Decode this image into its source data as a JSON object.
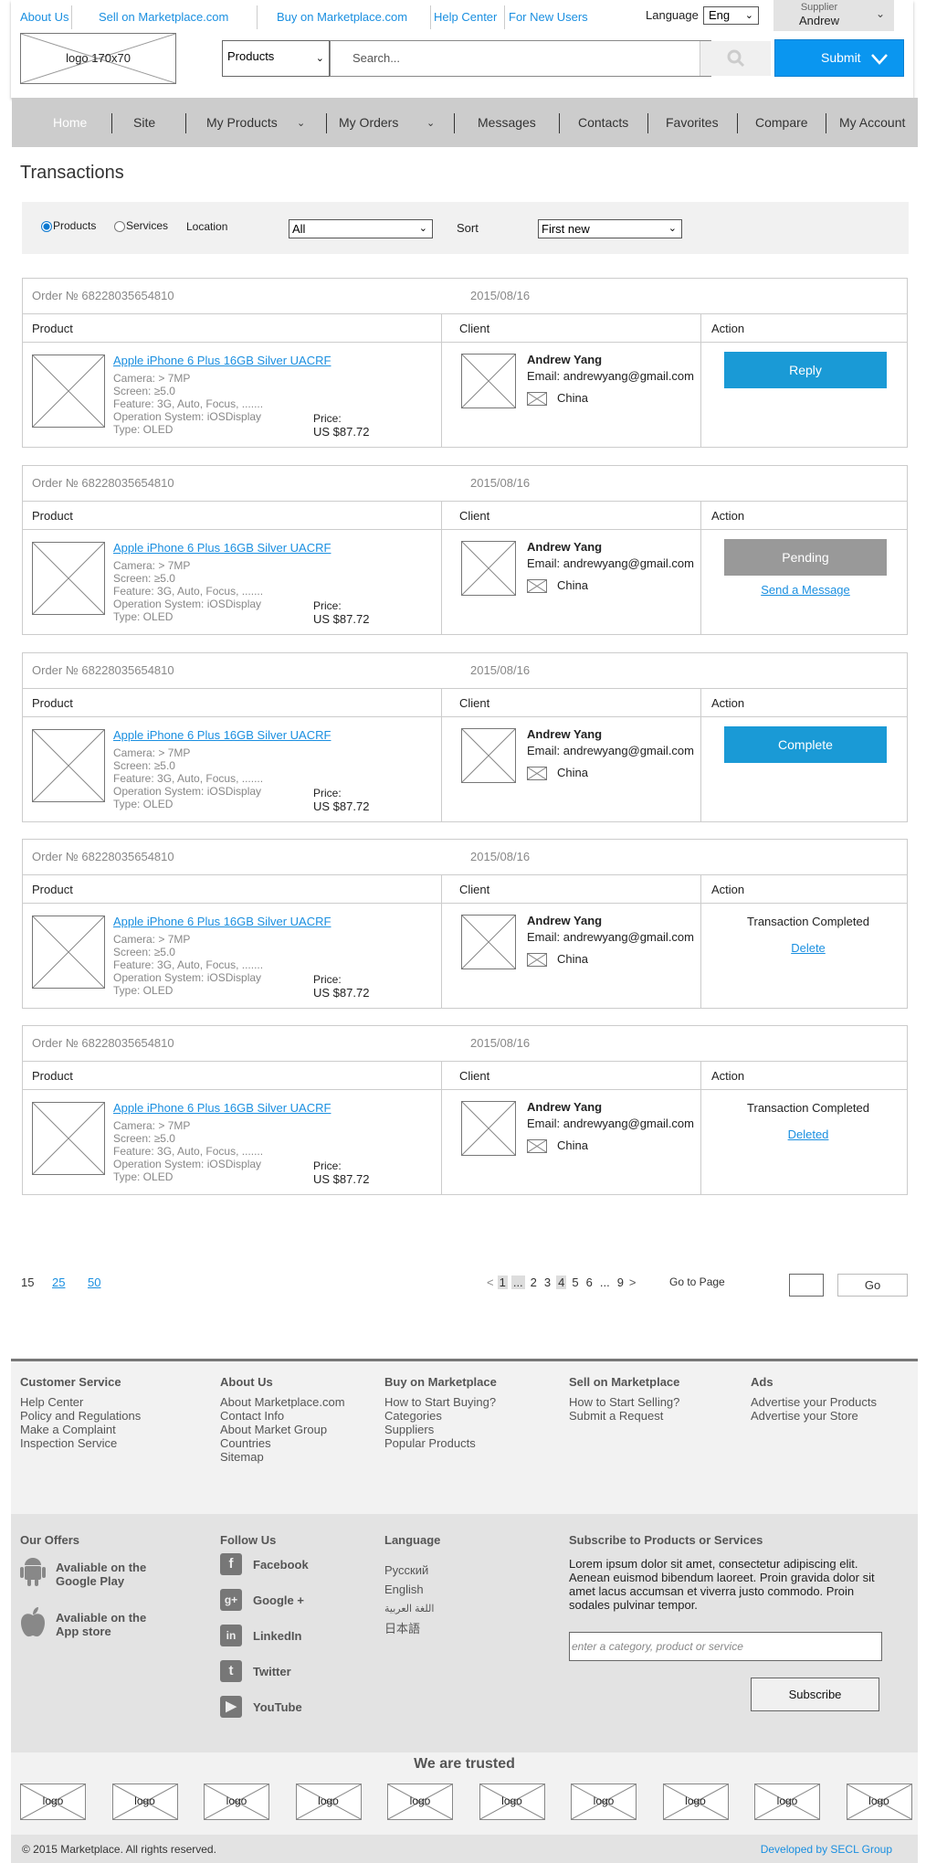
{
  "header": {
    "top_links": [
      "About Us",
      "Sell on Marketplace.com",
      "Buy on Marketplace.com",
      "Help Center",
      "For New Users"
    ],
    "language_label": "Language",
    "language_value": "Eng",
    "account_role": "Supplier",
    "account_name": "Andrew",
    "logo_text": "logo 170x70",
    "search_category": "Products",
    "search_placeholder": "Search...",
    "submit_label": "Submit"
  },
  "nav": {
    "items": [
      "Home",
      "Site",
      "My Products",
      "My Orders",
      "Messages",
      "Contacts",
      "Favorites",
      "Compare",
      "My Account"
    ],
    "active": "Home"
  },
  "page_title": "Transactions",
  "filters": {
    "type_options": [
      "Products",
      "Services"
    ],
    "type_selected": "Products",
    "location_label": "Location",
    "location_value": "All",
    "sort_label": "Sort",
    "sort_value": "First new"
  },
  "columns": {
    "product": "Product",
    "client": "Client",
    "action": "Action"
  },
  "orders": [
    {
      "order_no": "Order № 68228035654810",
      "date": "2015/08/16",
      "product_title": "Apple iPhone 6 Plus 16GB Silver UACRF",
      "specs": [
        "Camera: > 7MP",
        "Screen: ≥5.0",
        "Feature: 3G, Auto, Focus, .......",
        "Operation System: iOSDisplay",
        "Type: OLED"
      ],
      "price_label": "Price:",
      "price": "US $87.72",
      "client_name": "Andrew Yang",
      "client_email": "Email: andrewyang@gmail.com",
      "client_country": "China",
      "action_type": "button",
      "action_label": "Reply",
      "action_color": "#1a9ad6",
      "action_link": ""
    },
    {
      "order_no": "Order № 68228035654810",
      "date": "2015/08/16",
      "product_title": "Apple iPhone 6 Plus 16GB Silver UACRF",
      "specs": [
        "Camera: > 7MP",
        "Screen: ≥5.0",
        "Feature: 3G, Auto, Focus, .......",
        "Operation System: iOSDisplay",
        "Type: OLED"
      ],
      "price_label": "Price:",
      "price": "US $87.72",
      "client_name": "Andrew Yang",
      "client_email": "Email: andrewyang@gmail.com",
      "client_country": "China",
      "action_type": "button",
      "action_label": "Pending",
      "action_color": "#999999",
      "action_link": "Send a Message"
    },
    {
      "order_no": "Order № 68228035654810",
      "date": "2015/08/16",
      "product_title": "Apple iPhone 6 Plus 16GB Silver UACRF",
      "specs": [
        "Camera: > 7MP",
        "Screen: ≥5.0",
        "Feature: 3G, Auto, Focus, .......",
        "Operation System: iOSDisplay",
        "Type: OLED"
      ],
      "price_label": "Price:",
      "price": "US $87.72",
      "client_name": "Andrew Yang",
      "client_email": "Email: andrewyang@gmail.com",
      "client_country": "China",
      "action_type": "button",
      "action_label": "Complete",
      "action_color": "#1a9ad6",
      "action_link": ""
    },
    {
      "order_no": "Order № 68228035654810",
      "date": "2015/08/16",
      "product_title": "Apple iPhone 6 Plus 16GB Silver UACRF",
      "specs": [
        "Camera: > 7MP",
        "Screen: ≥5.0",
        "Feature: 3G, Auto, Focus, .......",
        "Operation System: iOSDisplay",
        "Type: OLED"
      ],
      "price_label": "Price:",
      "price": "US $87.72",
      "client_name": "Andrew Yang",
      "client_email": "Email: andrewyang@gmail.com",
      "client_country": "China",
      "action_type": "text",
      "action_label": "Transaction Completed",
      "action_color": "",
      "action_link": "Delete"
    },
    {
      "order_no": "Order № 68228035654810",
      "date": "2015/08/16",
      "product_title": "Apple iPhone 6 Plus 16GB Silver UACRF",
      "specs": [
        "Camera: > 7MP",
        "Screen: ≥5.0",
        "Feature: 3G, Auto, Focus, .......",
        "Operation System: iOSDisplay",
        "Type: OLED"
      ],
      "price_label": "Price:",
      "price": "US $87.72",
      "client_name": "Andrew Yang",
      "client_email": "Email: andrewyang@gmail.com",
      "client_country": "China",
      "action_type": "text",
      "action_label": "Transaction Completed",
      "action_color": "",
      "action_link": "Deleted"
    }
  ],
  "pagination": {
    "per_page": [
      "15",
      "25",
      "50"
    ],
    "prev": "<",
    "pages": [
      "1",
      "...",
      "2",
      "3",
      "4",
      "5",
      "6",
      "...",
      "9"
    ],
    "current": "4",
    "next": ">",
    "goto_label": "Go to Page",
    "go_label": "Go"
  },
  "footer": {
    "columns": [
      {
        "title": "Customer Service",
        "links": [
          "Help Center",
          "Policy and Regulations",
          "Make a Complaint",
          "Inspection Service"
        ]
      },
      {
        "title": "About Us",
        "links": [
          "About Marketplace.com",
          "Contact Info",
          "About Market Group",
          "Countries",
          "Sitemap"
        ]
      },
      {
        "title": "Buy on Marketplace",
        "links": [
          "How to Start Buying?",
          "Categories",
          "Suppliers",
          "Popular Products"
        ]
      },
      {
        "title": "Sell on Marketplace",
        "links": [
          "How to Start Selling?",
          "Submit a Request"
        ]
      },
      {
        "title": "Ads",
        "links": [
          "Advertise your Products",
          "Advertise your Store"
        ]
      }
    ],
    "offers": {
      "title": "Our Offers",
      "items": [
        {
          "icon": "android-icon",
          "line1": "Avaliable on the",
          "line2": "Google Play"
        },
        {
          "icon": "apple-icon",
          "line1": "Avaliable on the",
          "line2": "App store"
        }
      ]
    },
    "follow": {
      "title": "Follow Us",
      "items": [
        {
          "icon": "facebook-icon",
          "glyph": "f",
          "label": "Facebook"
        },
        {
          "icon": "google-plus-icon",
          "glyph": "g+",
          "label": "Google +"
        },
        {
          "icon": "linkedin-icon",
          "glyph": "in",
          "label": "LinkedIn"
        },
        {
          "icon": "twitter-icon",
          "glyph": "t",
          "label": "Twitter"
        },
        {
          "icon": "youtube-icon",
          "glyph": "▶",
          "label": "YouTube"
        }
      ]
    },
    "language": {
      "title": "Language",
      "items": [
        "Русский",
        "English",
        "اللغة العربية",
        "日本語"
      ]
    },
    "subscribe": {
      "title": "Subscribe to Products or Services",
      "text": "Lorem ipsum dolor sit amet, consectetur adipiscing elit. Aenean euismod bibendum laoreet. Proin gravida dolor sit amet lacus accumsan et viverra justo commodo. Proin sodales pulvinar tempor.",
      "placeholder": "enter a category, product or service",
      "button": "Subscribe"
    },
    "trusted_title": "We are trusted",
    "trusted_logo": "logo",
    "copyright": "© 2015 Marketplace. All rights reserved.",
    "developer": "Developed by SECL Group"
  },
  "colors": {
    "accent": "#0a96f0",
    "action_blue": "#1a9ad6",
    "pending_gray": "#999999",
    "nav_bg": "#cccccc"
  }
}
